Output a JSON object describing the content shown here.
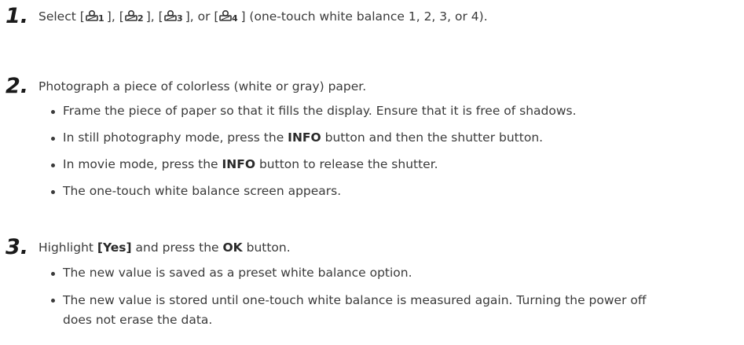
{
  "steps": [
    {
      "number": "1.",
      "text_parts": {
        "a": "Select [",
        "b": "], [",
        "c": "], [",
        "d": "], or [",
        "e": "] (one-touch white balance 1, 2, 3, or 4)."
      },
      "icons": [
        {
          "name": "one-touch-wb-1-icon",
          "digit": "1"
        },
        {
          "name": "one-touch-wb-2-icon",
          "digit": "2"
        },
        {
          "name": "one-touch-wb-3-icon",
          "digit": "3"
        },
        {
          "name": "one-touch-wb-4-icon",
          "digit": "4"
        }
      ]
    },
    {
      "number": "2.",
      "text": "Photograph a piece of colorless (white or gray) paper.",
      "bullets": [
        {
          "text": "Frame the piece of paper so that it fills the display. Ensure that it is free of shadows."
        },
        {
          "pre": "In still photography mode, press the ",
          "bold": "INFO",
          "post": " button and then the shutter button."
        },
        {
          "pre": "In movie mode, press the ",
          "bold": "INFO",
          "post": " button to release the shutter."
        },
        {
          "text": "The one-touch white balance screen appears."
        }
      ]
    },
    {
      "number": "3.",
      "text_pre": "Highlight ",
      "text_bold1": "[Yes]",
      "text_mid": " and press the ",
      "text_bold2": "OK",
      "text_post": " button.",
      "bullets": [
        {
          "text": "The new value is saved as a preset white balance option."
        },
        {
          "text": "The new value is stored until one-touch white balance is measured again. Turning the power off does not erase the data."
        }
      ]
    }
  ]
}
